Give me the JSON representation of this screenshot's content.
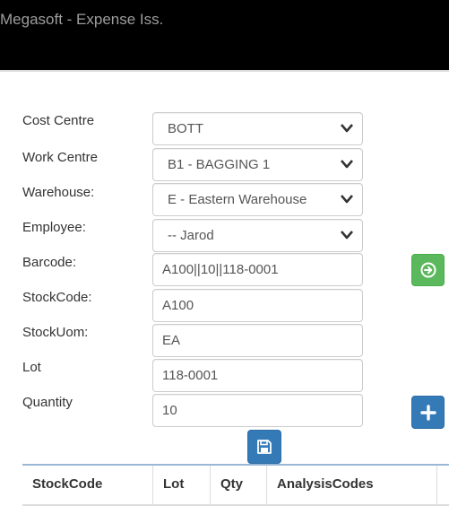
{
  "app": {
    "title": "Megasoft - Expense Iss."
  },
  "form": {
    "cost_centre": {
      "label": "Cost Centre",
      "value": "BOTT"
    },
    "work_centre": {
      "label": "Work Centre",
      "value": "B1 - BAGGING 1"
    },
    "warehouse": {
      "label": "Warehouse:",
      "value": "E - Eastern Warehouse"
    },
    "employee": {
      "label": "Employee:",
      "value": "-- Jarod"
    },
    "barcode": {
      "label": "Barcode:",
      "value": "A100||10||118-0001"
    },
    "stock_code": {
      "label": "StockCode:",
      "value": "A100"
    },
    "stock_uom": {
      "label": "StockUom:",
      "value": "EA"
    },
    "lot": {
      "label": "Lot",
      "value": "118-0001"
    },
    "quantity": {
      "label": "Quantity",
      "value": "10"
    }
  },
  "buttons": {
    "go_icon": "arrow-circle-right-icon",
    "add_icon": "plus-icon",
    "save_icon": "floppy-disk-icon",
    "go_color": "#5cb85c",
    "primary_color": "#337ab7"
  },
  "table": {
    "columns": [
      "StockCode",
      "Lot",
      "Qty",
      "AnalysisCodes"
    ]
  }
}
